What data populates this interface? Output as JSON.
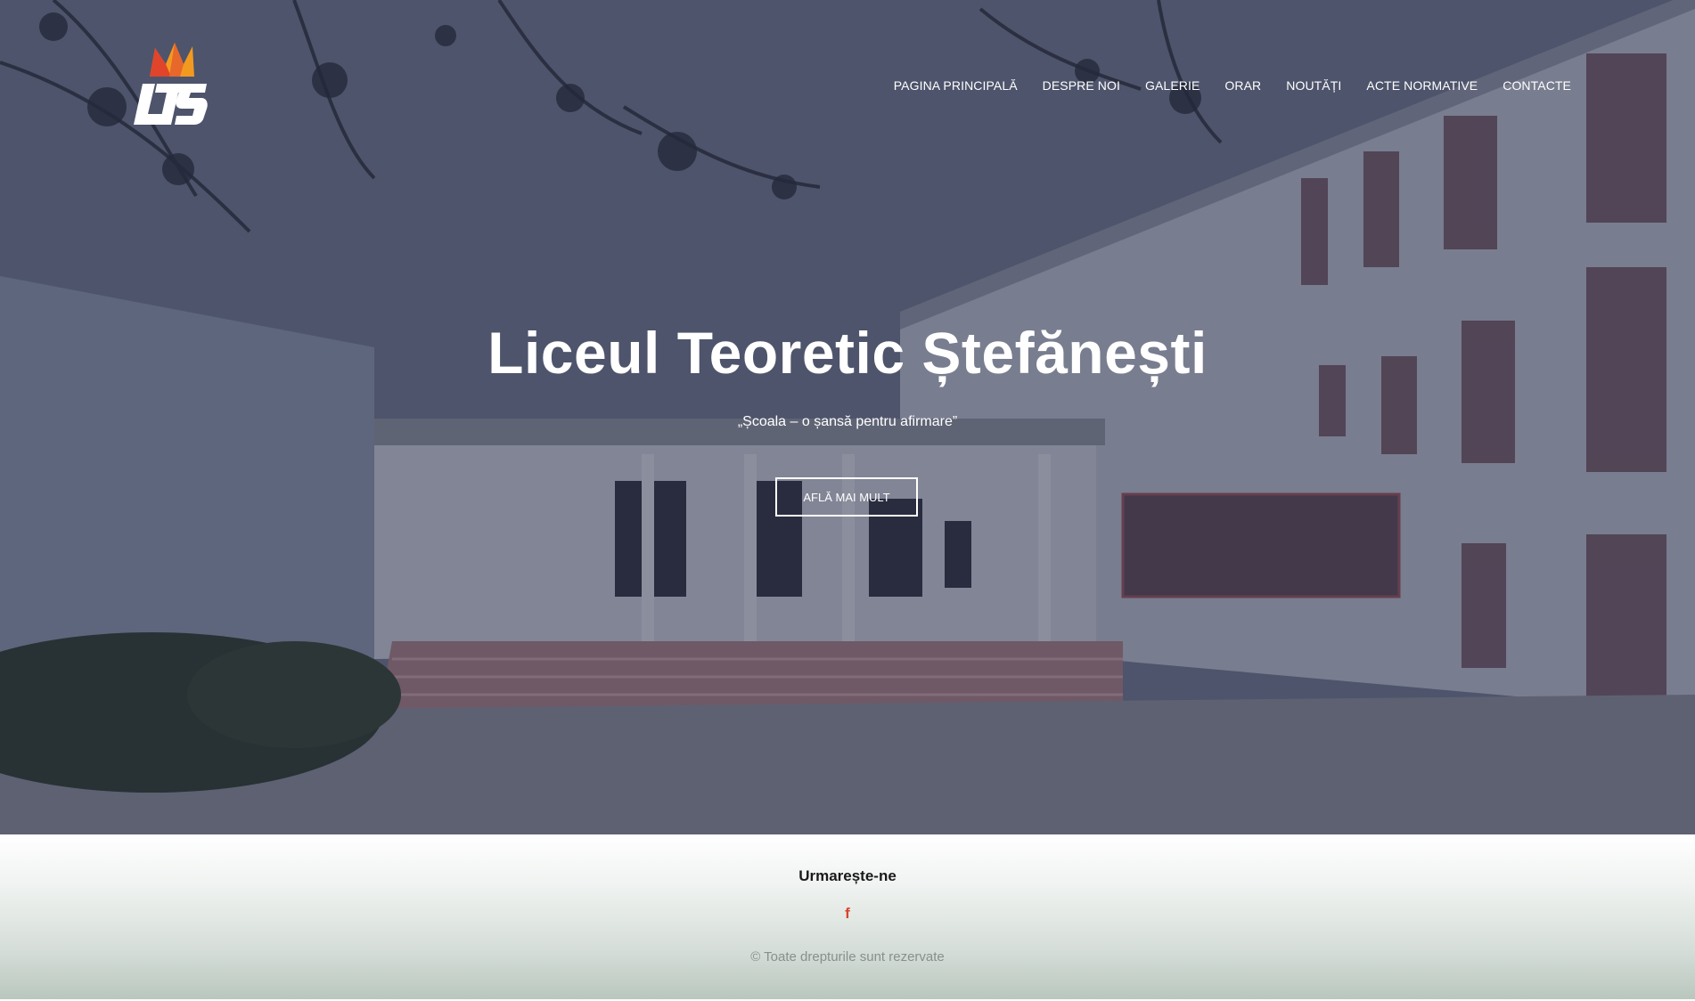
{
  "header": {
    "logo_text": "LTS",
    "nav": [
      {
        "label": "PAGINA PRINCIPALĂ"
      },
      {
        "label": "DESPRE NOI"
      },
      {
        "label": "GALERIE"
      },
      {
        "label": "ORAR"
      },
      {
        "label": "NOUTĂȚI"
      },
      {
        "label": "ACTE NORMATIVE"
      },
      {
        "label": "CONTACTE"
      }
    ]
  },
  "hero": {
    "title": "Liceul Teoretic Ștefănești",
    "tagline": "„Școala – o șansă pentru afirmare”",
    "button_label": "AFLĂ MAI MULT"
  },
  "footer": {
    "heading": "Urmarește-ne",
    "social_icon": "facebook-icon",
    "copyright": "© Toate drepturile sunt rezervate"
  },
  "colors": {
    "overlay": "#222842",
    "accent_red": "#d9432a",
    "logo_orange": "#f29a1f",
    "logo_red": "#e0442b"
  }
}
